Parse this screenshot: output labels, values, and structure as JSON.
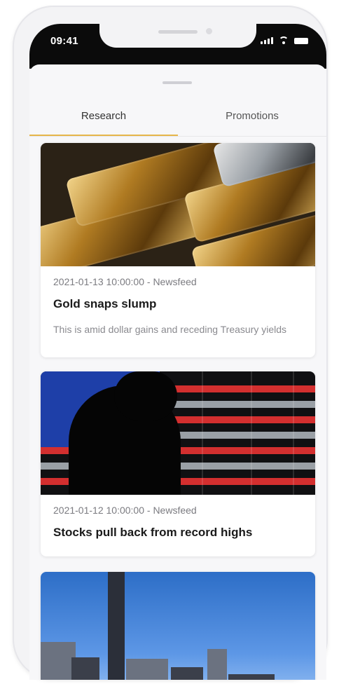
{
  "status_bar": {
    "time": "09:41"
  },
  "tabs": [
    {
      "label": "Research",
      "active": true
    },
    {
      "label": "Promotions",
      "active": false
    }
  ],
  "accent_color": "#e6b64a",
  "articles": [
    {
      "meta": "2021-01-13 10:00:00 - Newsfeed",
      "title": "Gold snaps slump",
      "summary": "This is amid dollar gains and receding Treasury yields"
    },
    {
      "meta": "2021-01-12 10:00:00 - Newsfeed",
      "title": "Stocks pull back from record highs",
      "summary": ""
    },
    {
      "meta": "",
      "title": "",
      "summary": ""
    }
  ],
  "images": {
    "card1": "gold-bars-photo",
    "card2": "american-flag-led-photo",
    "card3": "city-skyline-photo"
  }
}
